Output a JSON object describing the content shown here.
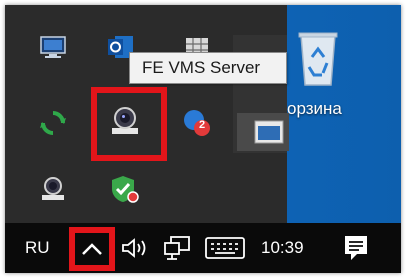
{
  "tooltip": {
    "text": "FE VMS Server"
  },
  "desktop": {
    "recycle_bin_label": "орзина"
  },
  "taskbar": {
    "language": "RU",
    "clock": "10:39"
  },
  "tray_icons": [
    {
      "name": "display-icon"
    },
    {
      "name": "outlook-icon"
    },
    {
      "name": "grid-app-icon"
    },
    {
      "name": "sync-icon"
    },
    {
      "name": "fe-vms-server-icon"
    },
    {
      "name": "chat-badge-icon",
      "badge": "2"
    },
    {
      "name": "camera-client-icon"
    },
    {
      "name": "shield-check-icon"
    }
  ],
  "colors": {
    "highlight": "#e3151a",
    "taskbar": "#0a0a0a",
    "tray_popup": "#2b2b2b",
    "desktop": "#0b5ea8"
  }
}
